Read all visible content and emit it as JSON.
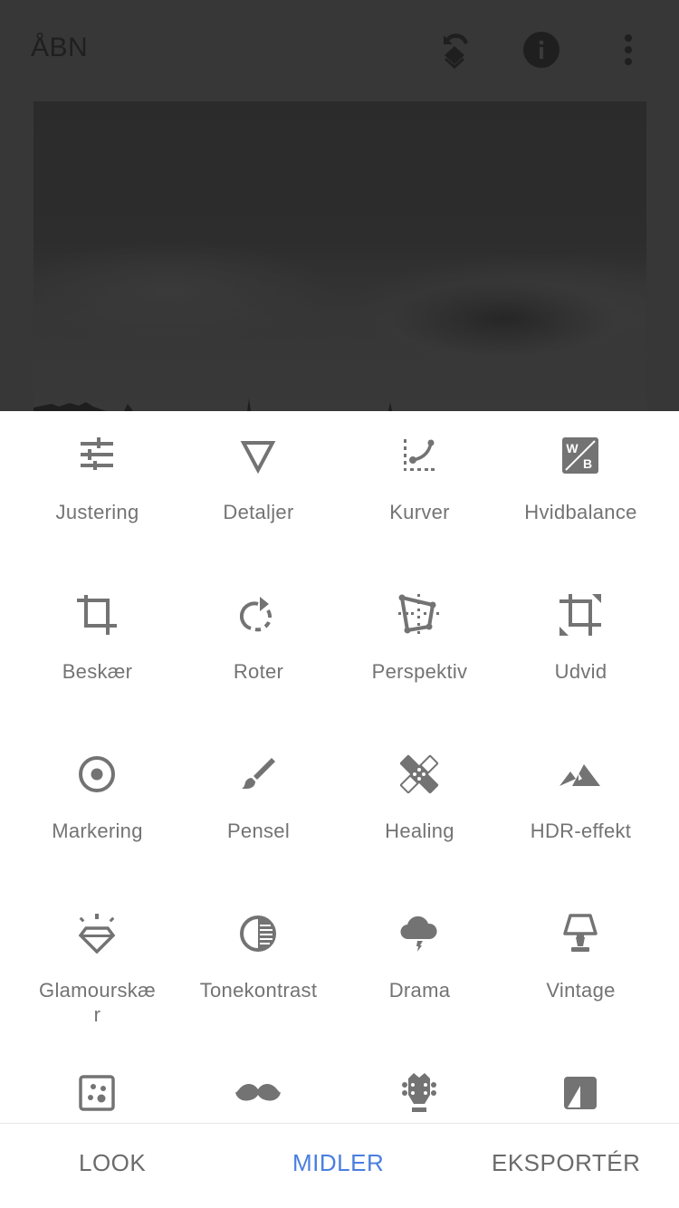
{
  "header": {
    "title": "ÅBN",
    "icons": [
      "undo-stack-icon",
      "info-icon",
      "more-vert-icon"
    ]
  },
  "photo": {
    "description": "cloudy sky photograph, dimmed"
  },
  "tools": [
    {
      "label": "Justering",
      "icon": "tune-icon"
    },
    {
      "label": "Detaljer",
      "icon": "details-triangle-icon"
    },
    {
      "label": "Kurver",
      "icon": "curves-icon"
    },
    {
      "label": "Hvidbalance",
      "icon": "white-balance-icon"
    },
    {
      "label": "Beskær",
      "icon": "crop-icon"
    },
    {
      "label": "Roter",
      "icon": "rotate-icon"
    },
    {
      "label": "Perspektiv",
      "icon": "perspective-icon"
    },
    {
      "label": "Udvid",
      "icon": "expand-icon"
    },
    {
      "label": "Markering",
      "icon": "selective-icon"
    },
    {
      "label": "Pensel",
      "icon": "brush-icon"
    },
    {
      "label": "Healing",
      "icon": "healing-icon"
    },
    {
      "label": "HDR-effekt",
      "icon": "hdr-mountain-icon"
    },
    {
      "label": "Glamourskær",
      "icon": "glamour-diamond-icon"
    },
    {
      "label": "Tonekontrast",
      "icon": "tonal-contrast-icon"
    },
    {
      "label": "Drama",
      "icon": "drama-cloud-icon"
    },
    {
      "label": "Vintage",
      "icon": "vintage-lamp-icon"
    },
    {
      "label": "",
      "icon": "grainy-film-icon"
    },
    {
      "label": "",
      "icon": "retrolux-mustache-icon"
    },
    {
      "label": "",
      "icon": "grunge-guitar-icon"
    },
    {
      "label": "",
      "icon": "black-white-icon"
    }
  ],
  "bottom_nav": {
    "tabs": [
      {
        "label": "LOOK",
        "active": false
      },
      {
        "label": "MIDLER",
        "active": true
      },
      {
        "label": "EKSPORTÉR",
        "active": false
      }
    ]
  },
  "colors": {
    "icon": "#737373",
    "label": "#737373",
    "active_tab": "#4a7fe0",
    "overlay_bg": "#373737"
  }
}
